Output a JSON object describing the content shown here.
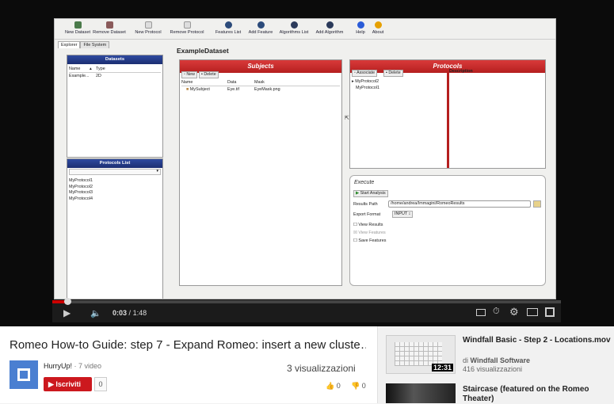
{
  "toolbar": [
    {
      "label": "New Dataset",
      "icon": "dataset-add-icon",
      "color": "#4a7a4a"
    },
    {
      "label": "Remove Dataset",
      "icon": "dataset-remove-icon",
      "color": "#8a5a5a"
    },
    {
      "label": "New Protocol",
      "icon": "protocol-add-icon",
      "color": "#999999"
    },
    {
      "label": "Remove Protocol",
      "icon": "protocol-remove-icon",
      "color": "#999999"
    },
    {
      "label": "Features List",
      "icon": "features-list-icon",
      "color": "#2b4a7a"
    },
    {
      "label": "Add Feature",
      "icon": "add-feature-icon",
      "color": "#2b4a7a"
    },
    {
      "label": "Algorithms List",
      "icon": "algorithms-list-icon",
      "color": "#2b3a5a"
    },
    {
      "label": "Add Algorithm",
      "icon": "add-algorithm-icon",
      "color": "#2b3a5a"
    },
    {
      "label": "Help",
      "icon": "help-icon",
      "color": "#2a5bd7"
    },
    {
      "label": "About",
      "icon": "info-icon",
      "color": "#e6a000"
    }
  ],
  "tabs": {
    "explorer": "Explorer",
    "filesystem": "File System"
  },
  "datasets": {
    "title": "Datasets",
    "col_name": "Name",
    "col_type": "Type",
    "row_name": "Example...",
    "row_type": "2D"
  },
  "protocols_list": {
    "title": "Protocols List",
    "items": [
      "MyProtocol1",
      "MyProtocol2",
      "MyProtocol3",
      "MyProtocol4"
    ]
  },
  "dataset_name": "ExampleDataset",
  "subjects": {
    "title": "Subjects",
    "new": "New",
    "delete": "Delete",
    "col_name": "Name",
    "col_data": "Data",
    "col_mask": "Mask",
    "row": {
      "name": "MySubject",
      "data": "Eye.tif",
      "mask": "EyeMask.png"
    }
  },
  "protocols": {
    "title": "Protocols",
    "associate": "Associate",
    "delete": "Delete",
    "items": [
      "MyProtocol2",
      "MyProtocol1"
    ],
    "description": "Description"
  },
  "execute": {
    "title": "Execute",
    "start": "Start Analysis",
    "results_label": "Results Path",
    "results_value": "/home/andrea/Immagini/RomeoResults",
    "export_label": "Export Format",
    "export_value": "INPUT",
    "view_results": "View Results",
    "view_features": "View Features",
    "save_features": "Save Features"
  },
  "player": {
    "time": "0:03",
    "duration": "1:48",
    "sep": "/",
    "progress": 0.03
  },
  "video": {
    "title": "Romeo How-to Guide: step 7 - Expand Romeo: insert a new cluste…",
    "channel": "HurryUp!",
    "channel_videos": "· 7 video",
    "subscribe": "Iscriviti",
    "subscribers": "0",
    "views": "3 visualizzazioni",
    "likes": "0",
    "dislikes": "0"
  },
  "related": [
    {
      "title": "Windfall Basic - Step 2 - Locations.mov",
      "by": "di",
      "channel": "Windfall Software",
      "views": "416 visualizzazioni",
      "duration": "12:31"
    },
    {
      "title": "Staircase (featured on the Romeo Theater)",
      "duration": ""
    }
  ],
  "colors": {
    "accent": "#cc181e",
    "panel_blue": "#1b2e72",
    "panel_red": "#b51f1f"
  }
}
